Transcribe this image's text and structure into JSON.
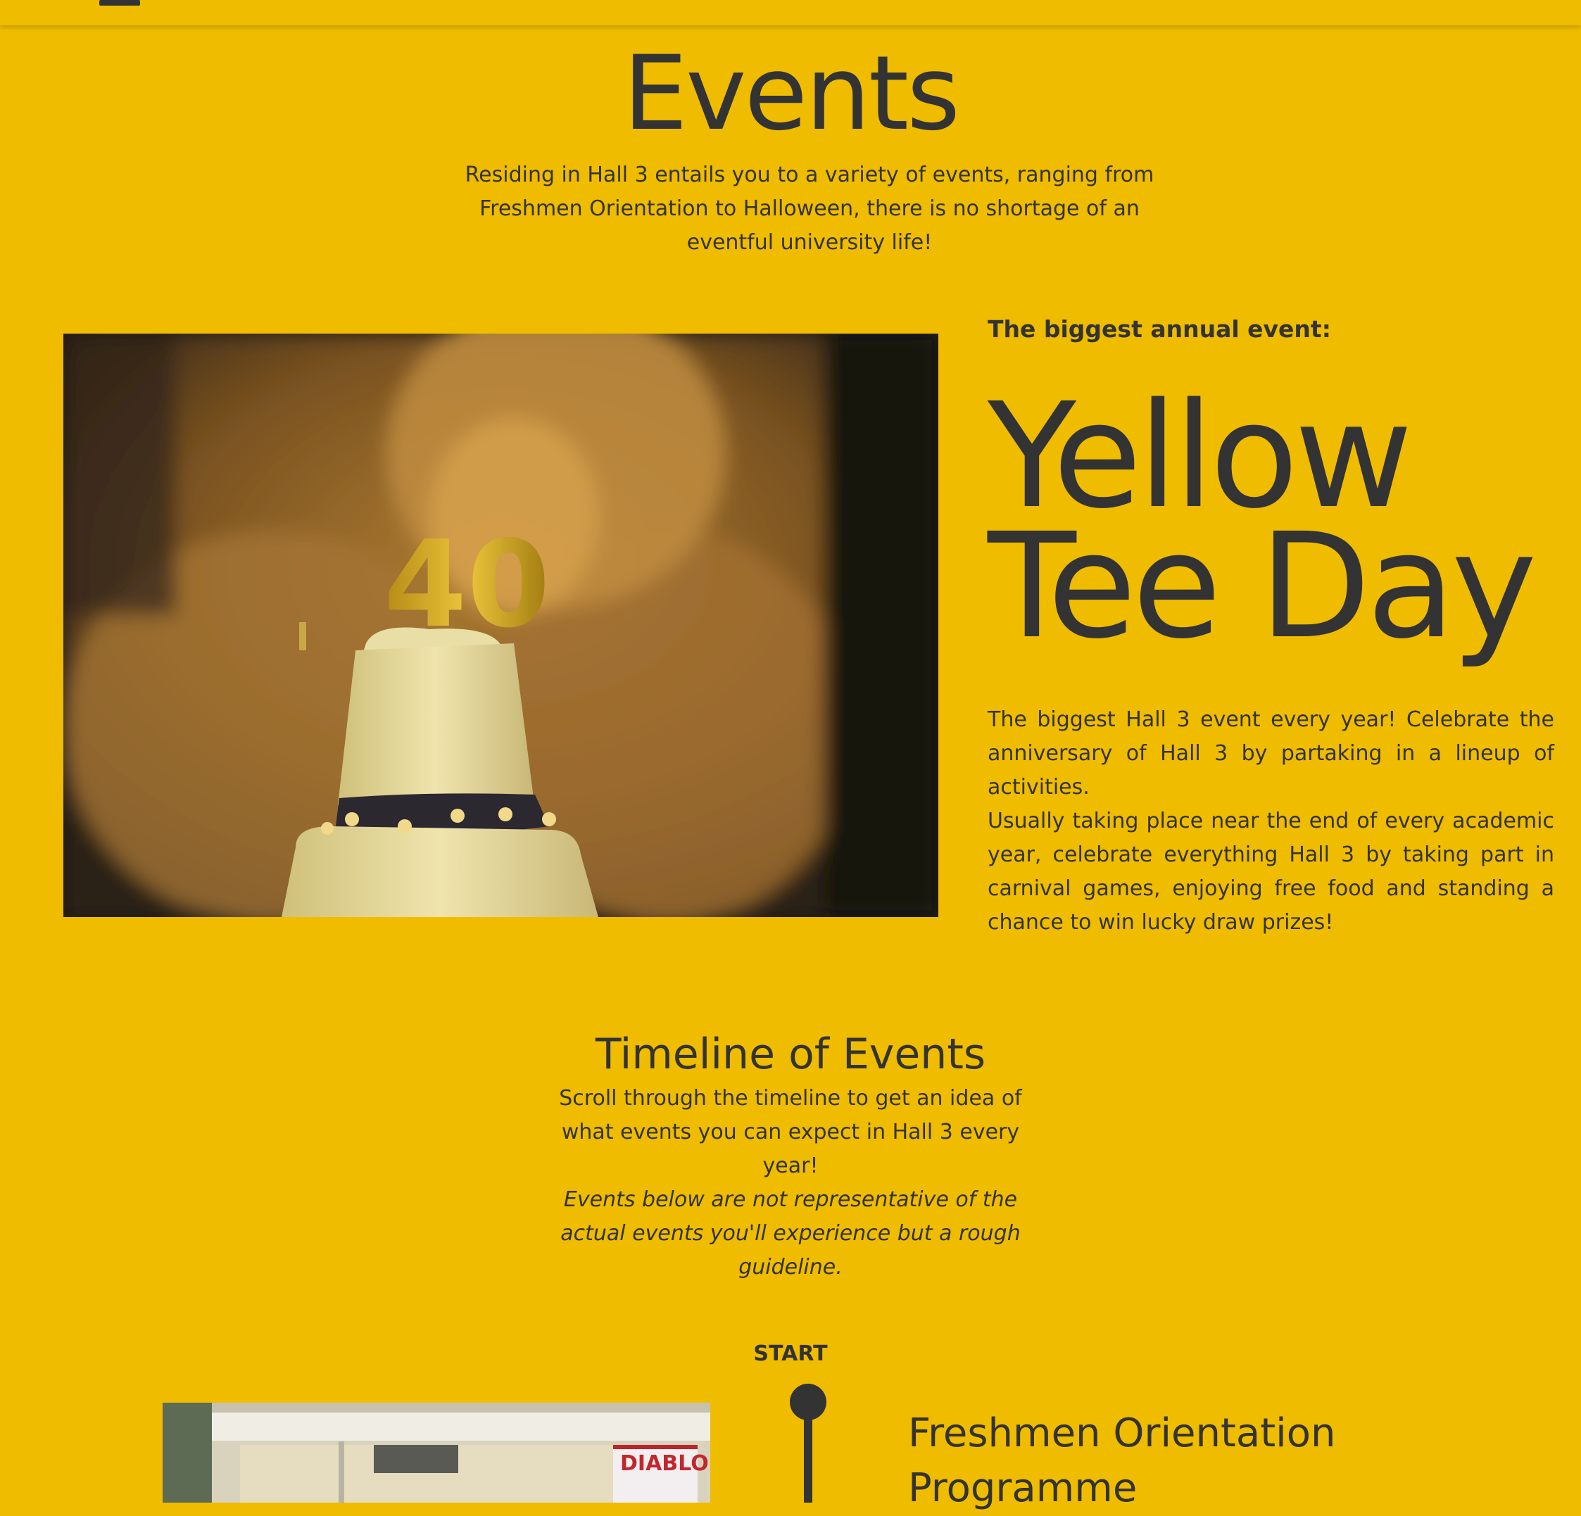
{
  "header": {
    "menu_icon": "menu-icon"
  },
  "page": {
    "title": "Events",
    "intro": "Residing in Hall 3 entails you to a variety of events, ranging from Freshmen Orientation to Halloween, there is no shortage of an eventful university life!"
  },
  "feature": {
    "image_icon": "birthday-cake-photo",
    "kicker": "The biggest annual event:",
    "title_line1": "Yellow",
    "title_line2": "Tee Day",
    "paragraph1": "The biggest Hall 3 event every year! Celebrate the anniversary of Hall 3 by partaking in a lineup of activities.",
    "paragraph2": "Usually taking place near the end of every academic year, celebrate everything Hall 3 by taking part in carnival games, enjoying free food and standing a chance to win lucky draw prizes!",
    "candle_text": "40"
  },
  "timeline": {
    "title": "Timeline of Events",
    "subtitle": "Scroll through the timeline to get an idea of what events you can expect in Hall 3 every year!",
    "note": "Events below are not representative of the actual events you'll experience but a rough guideline.",
    "start_label": "START",
    "events": [
      {
        "title": "Freshmen Orientation Programme",
        "image_icon": "orientation-photo",
        "banner_text": "DIABLO"
      }
    ]
  },
  "colors": {
    "background": "#EFBC00",
    "text": "#333333"
  }
}
